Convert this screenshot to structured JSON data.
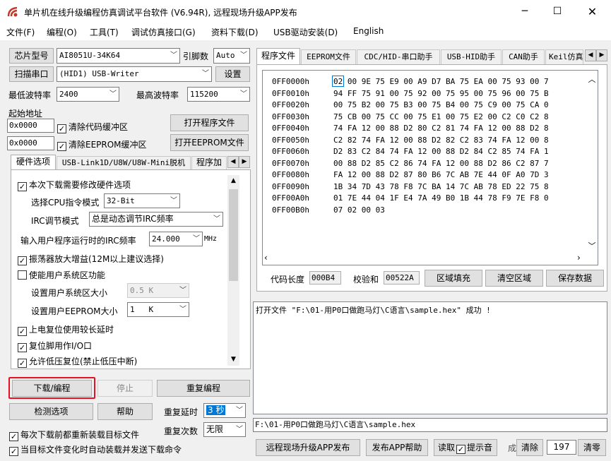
{
  "window": {
    "title": "单片机在线升级编程仿真调试平台软件 (V6.94R), 远程现场升级APP发布"
  },
  "menu": [
    "文件(F)",
    "编程(O)",
    "工具(T)",
    "调试仿真接口(G)",
    "资料下载(D)",
    "USB驱动安装(D)",
    "English"
  ],
  "left": {
    "chip_type_btn": "芯片型号",
    "chip_type": "AI8051U-34K64",
    "pin_count_label": "引脚数",
    "pin_count": "Auto",
    "scan_port_btn": "扫描串口",
    "port": "(HID1) USB-Writer",
    "settings_btn": "设置",
    "min_baud_label": "最低波特率",
    "min_baud": "2400",
    "max_baud_label": "最高波特率",
    "max_baud": "115200",
    "start_addr_label": "起始地址",
    "code_addr": "0x0000",
    "clear_code_buf": "清除代码缓冲区",
    "open_prog_btn": "打开程序文件",
    "eeprom_addr": "0x0000",
    "clear_eeprom_buf": "清除EEPROM缓冲区",
    "open_eeprom_btn": "打开EEPROM文件",
    "tabs": [
      "硬件选项",
      "USB-Link1D/U8W/U8W-Mini脱机",
      "程序加"
    ],
    "hw": {
      "opt1": "本次下载需要修改硬件选项",
      "cpu_label": "选择CPU指令模式",
      "cpu_val": "32-Bit",
      "irc_mode_label": "IRC调节模式",
      "irc_mode_val": "总是动态调节IRC频率",
      "irc_freq_label": "输入用户程序运行时的IRC频率",
      "irc_freq_val": "24.000",
      "irc_freq_unit": "MHz",
      "opt_osc": "振荡器放大增益(12M以上建议选择)",
      "opt_sysarea": "使能用户系统区功能",
      "sys_size_label": "设置用户系统区大小",
      "sys_size_val": "0.5 K",
      "eeprom_size_label": "设置用户EEPROM大小",
      "eeprom_size_val": "1   K",
      "opt_reset_delay": "上电复位使用较长延时",
      "opt_reset_pin": "复位脚用作I/O口",
      "opt_lvr": "允许低压复位(禁止低压中断)"
    },
    "download_btn": "下载/编程",
    "stop_btn": "停止",
    "reprog_btn": "重复编程",
    "check_btn": "检测选项",
    "help_btn": "帮助",
    "repeat_delay_label": "重复延时",
    "repeat_delay_val": "3 秒",
    "repeat_count_label": "重复次数",
    "repeat_count_val": "无限",
    "reload_each": "每次下载前都重新装载目标文件",
    "auto_load": "当目标文件变化时自动装载并发送下载命令"
  },
  "right": {
    "tabs": [
      "程序文件",
      "EEPROM文件",
      "CDC/HID-串口助手",
      "USB-HID助手",
      "CAN助手",
      "Keil仿真"
    ],
    "hex_addresses": [
      "0FF0000h",
      "0FF0010h",
      "0FF0020h",
      "0FF0030h",
      "0FF0040h",
      "0FF0050h",
      "0FF0060h",
      "0FF0070h",
      "0FF0080h",
      "0FF0090h",
      "0FF00A0h",
      "0FF00B0h"
    ],
    "hex_data": [
      "02 00 9E 75 E9 00 A9 D7 BA 75 EA 00 75 93 00 7",
      "94 FF 75 91 00 75 92 00 75 95 00 75 96 00 75 B",
      "00 75 B2 00 75 B3 00 75 B4 00 75 C9 00 75 CA 0",
      "75 CB 00 75 CC 00 75 E1 00 75 E2 00 C2 C0 C2 8",
      "74 FA 12 00 88 D2 80 C2 81 74 FA 12 00 88 D2 8",
      "C2 82 74 FA 12 00 88 D2 82 C2 83 74 FA 12 00 8",
      "D2 83 C2 84 74 FA 12 00 88 D2 84 C2 85 74 FA 1",
      "00 88 D2 85 C2 86 74 FA 12 00 88 D2 86 C2 87 7",
      "FA 12 00 88 D2 87 80 B6 7C AB 7E 44 0F A0 7D 3",
      "1B 34 7D 43 78 F8 7C BA 14 7C AB 78 ED 22 75 8",
      "01 7E 44 04 1F E4 7A 49 B0 1B 44 78 F9 7E F8 0",
      "07 02 00 03"
    ],
    "code_len_label": "代码长度",
    "code_len": "000B4",
    "checksum_label": "校验和",
    "checksum": "00522A",
    "fill_btn": "区域填充",
    "clear_area_btn": "清空区域",
    "save_btn": "保存数据",
    "log": "打开文件 \"F:\\01-用P0口做跑马灯\\C语言\\sample.hex\" 成功 !",
    "file_path": "F:\\01-用P0口做跑马灯\\C语言\\sample.hex",
    "remote_btn": "远程现场升级APP发布",
    "publish_help_btn": "发布APP帮助",
    "read_label": "读取",
    "beep_label": "提示音",
    "count_label": "成",
    "clear_btn": "清除",
    "count_val": "197",
    "zero_btn": "清零"
  },
  "colors": {
    "highlight": "#e81123",
    "title_icon": "#c0392b",
    "selection": "#0078d7"
  }
}
